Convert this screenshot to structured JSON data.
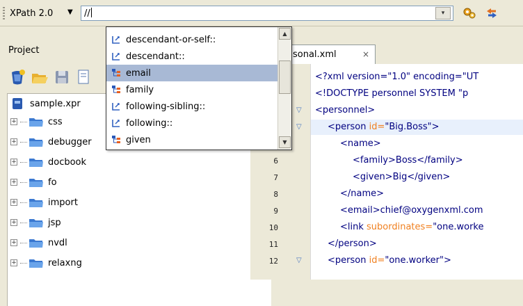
{
  "toolbar": {
    "xpath_version": "XPath 2.0",
    "xpath_dropdown_icon": "caret-down",
    "query_value": "//",
    "combo_arrow": "▾",
    "run_icon": "gears-icon",
    "toggle_icon": "arrows-icon"
  },
  "project": {
    "title": "Project",
    "tools": [
      "new-file-icon",
      "open-folder-icon",
      "save-icon",
      "properties-icon"
    ],
    "root": "sample.xpr",
    "folders": [
      "css",
      "debugger",
      "docbook",
      "fo",
      "import",
      "jsp",
      "nvdl",
      "relaxng"
    ]
  },
  "autocomplete": {
    "items": [
      {
        "label": "descendant-or-self::",
        "type": "axis"
      },
      {
        "label": "descendant::",
        "type": "axis"
      },
      {
        "label": "email",
        "type": "element",
        "selected": true
      },
      {
        "label": "family",
        "type": "element"
      },
      {
        "label": "following-sibling::",
        "type": "axis"
      },
      {
        "label": "following::",
        "type": "axis"
      },
      {
        "label": "given",
        "type": "element"
      }
    ]
  },
  "editor": {
    "tab_label": "sonal.xml",
    "tab_close": "×",
    "line_numbers": [
      "",
      "",
      "",
      "",
      "",
      "6",
      "7",
      "8",
      "9",
      "10",
      "11",
      "12"
    ],
    "lines": [
      {
        "parts": [
          [
            "tag",
            "<?xml version=\"1.0\" encoding=\"UT"
          ]
        ]
      },
      {
        "parts": [
          [
            "tag",
            "<!DOCTYPE personnel SYSTEM \"p"
          ]
        ]
      },
      {
        "parts": [
          [
            "tag",
            "<personnel>"
          ]
        ]
      },
      {
        "parts": [
          [
            "tag",
            "<person"
          ],
          [
            "att",
            " id="
          ],
          [
            "val",
            "\"Big.Boss\">"
          ]
        ],
        "indent": 1,
        "highlight": true
      },
      {
        "parts": [
          [
            "tag",
            "<name>"
          ]
        ],
        "indent": 2
      },
      {
        "parts": [
          [
            "tag",
            "<family>Boss</family>"
          ]
        ],
        "indent": 3
      },
      {
        "parts": [
          [
            "tag",
            "<given>Big</given>"
          ]
        ],
        "indent": 3
      },
      {
        "parts": [
          [
            "tag",
            "</name>"
          ]
        ],
        "indent": 2
      },
      {
        "parts": [
          [
            "tag",
            "<email>chief@oxygenxml.com"
          ]
        ],
        "indent": 2
      },
      {
        "parts": [
          [
            "tag",
            "<link"
          ],
          [
            "att",
            " subordinates="
          ],
          [
            "val",
            "\"one.worke"
          ]
        ],
        "indent": 2
      },
      {
        "parts": [
          [
            "tag",
            "</person>"
          ]
        ],
        "indent": 1
      },
      {
        "parts": [
          [
            "tag",
            "<person"
          ],
          [
            "att",
            " id="
          ],
          [
            "val",
            "\"one.worker\">"
          ]
        ],
        "indent": 1
      }
    ]
  },
  "colors": {
    "tag": "#000080",
    "attribute": "#f08020",
    "selection": "#a8b9d5",
    "line_highlight": "#e8f0fc"
  }
}
